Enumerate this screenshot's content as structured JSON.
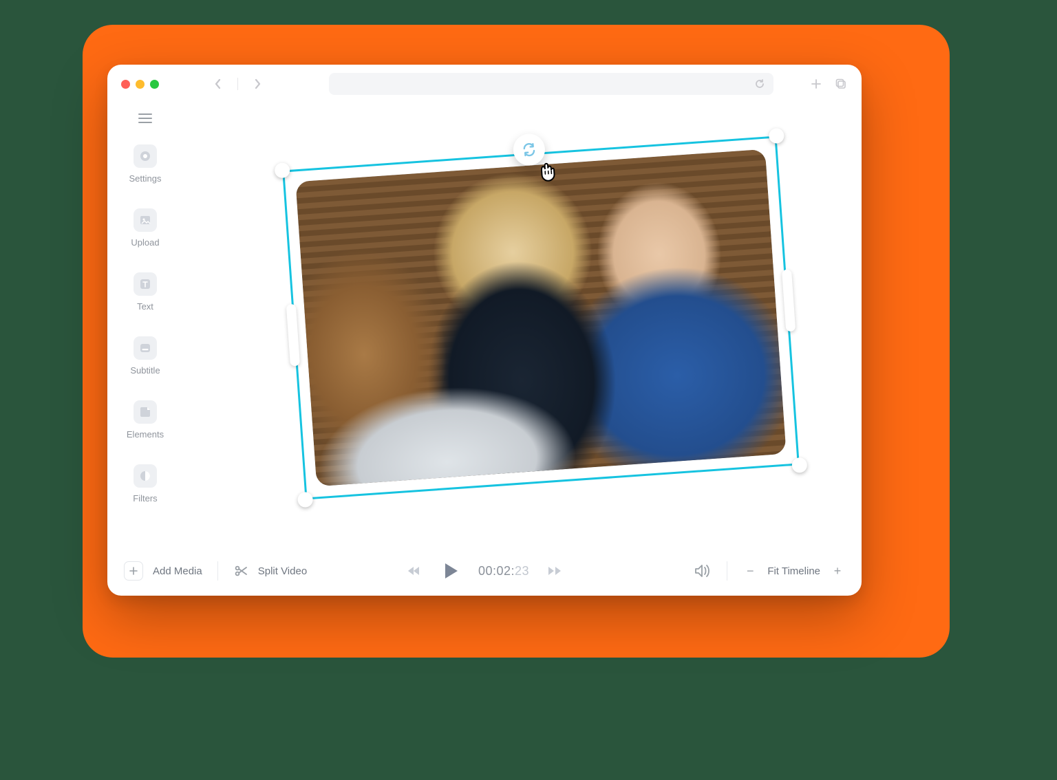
{
  "sidebar": {
    "items": [
      {
        "label": "Settings",
        "icon": "record-icon"
      },
      {
        "label": "Upload",
        "icon": "image-icon"
      },
      {
        "label": "Text",
        "icon": "text-icon"
      },
      {
        "label": "Subtitle",
        "icon": "subtitle-icon"
      },
      {
        "label": "Elements",
        "icon": "sticker-icon"
      },
      {
        "label": "Filters",
        "icon": "contrast-icon"
      }
    ]
  },
  "toolbar": {
    "add_media_label": "Add Media",
    "split_label": "Split Video",
    "timecode_main": "00:02:",
    "timecode_frames": "23",
    "fit_label": "Fit Timeline"
  },
  "canvas": {
    "rotation_deg": -4,
    "selection_color": "#16C3E0"
  },
  "window": {
    "traffic": [
      "close",
      "minimize",
      "zoom"
    ]
  }
}
